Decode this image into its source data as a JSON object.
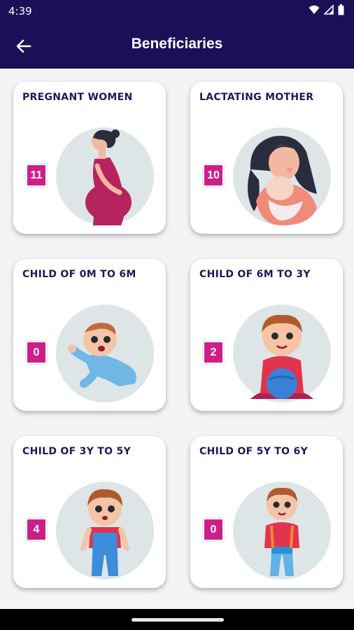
{
  "status": {
    "time": "4:39"
  },
  "appbar": {
    "title": "Beneficiaries",
    "back_icon": "arrow-left-icon"
  },
  "colors": {
    "primary": "#1d0f57",
    "badge": "#cd1f8a",
    "title_text": "#2a1458",
    "circle_bg": "#dde5e6"
  },
  "cards": [
    {
      "title": "PREGNANT WOMEN",
      "count": "11",
      "illustration": "pregnant-woman"
    },
    {
      "title": "LACTATING MOTHER",
      "count": "10",
      "illustration": "mother-with-baby"
    },
    {
      "title": "CHILD OF 0M TO 6M",
      "count": "0",
      "illustration": "crawling-baby"
    },
    {
      "title": "CHILD OF 6M TO 3Y",
      "count": "2",
      "illustration": "toddler-with-ball"
    },
    {
      "title": "CHILD OF 3Y TO 5Y",
      "count": "4",
      "illustration": "boy-in-overalls"
    },
    {
      "title": "CHILD OF 5Y TO 6Y",
      "count": "0",
      "illustration": "boy-with-backpack"
    }
  ]
}
